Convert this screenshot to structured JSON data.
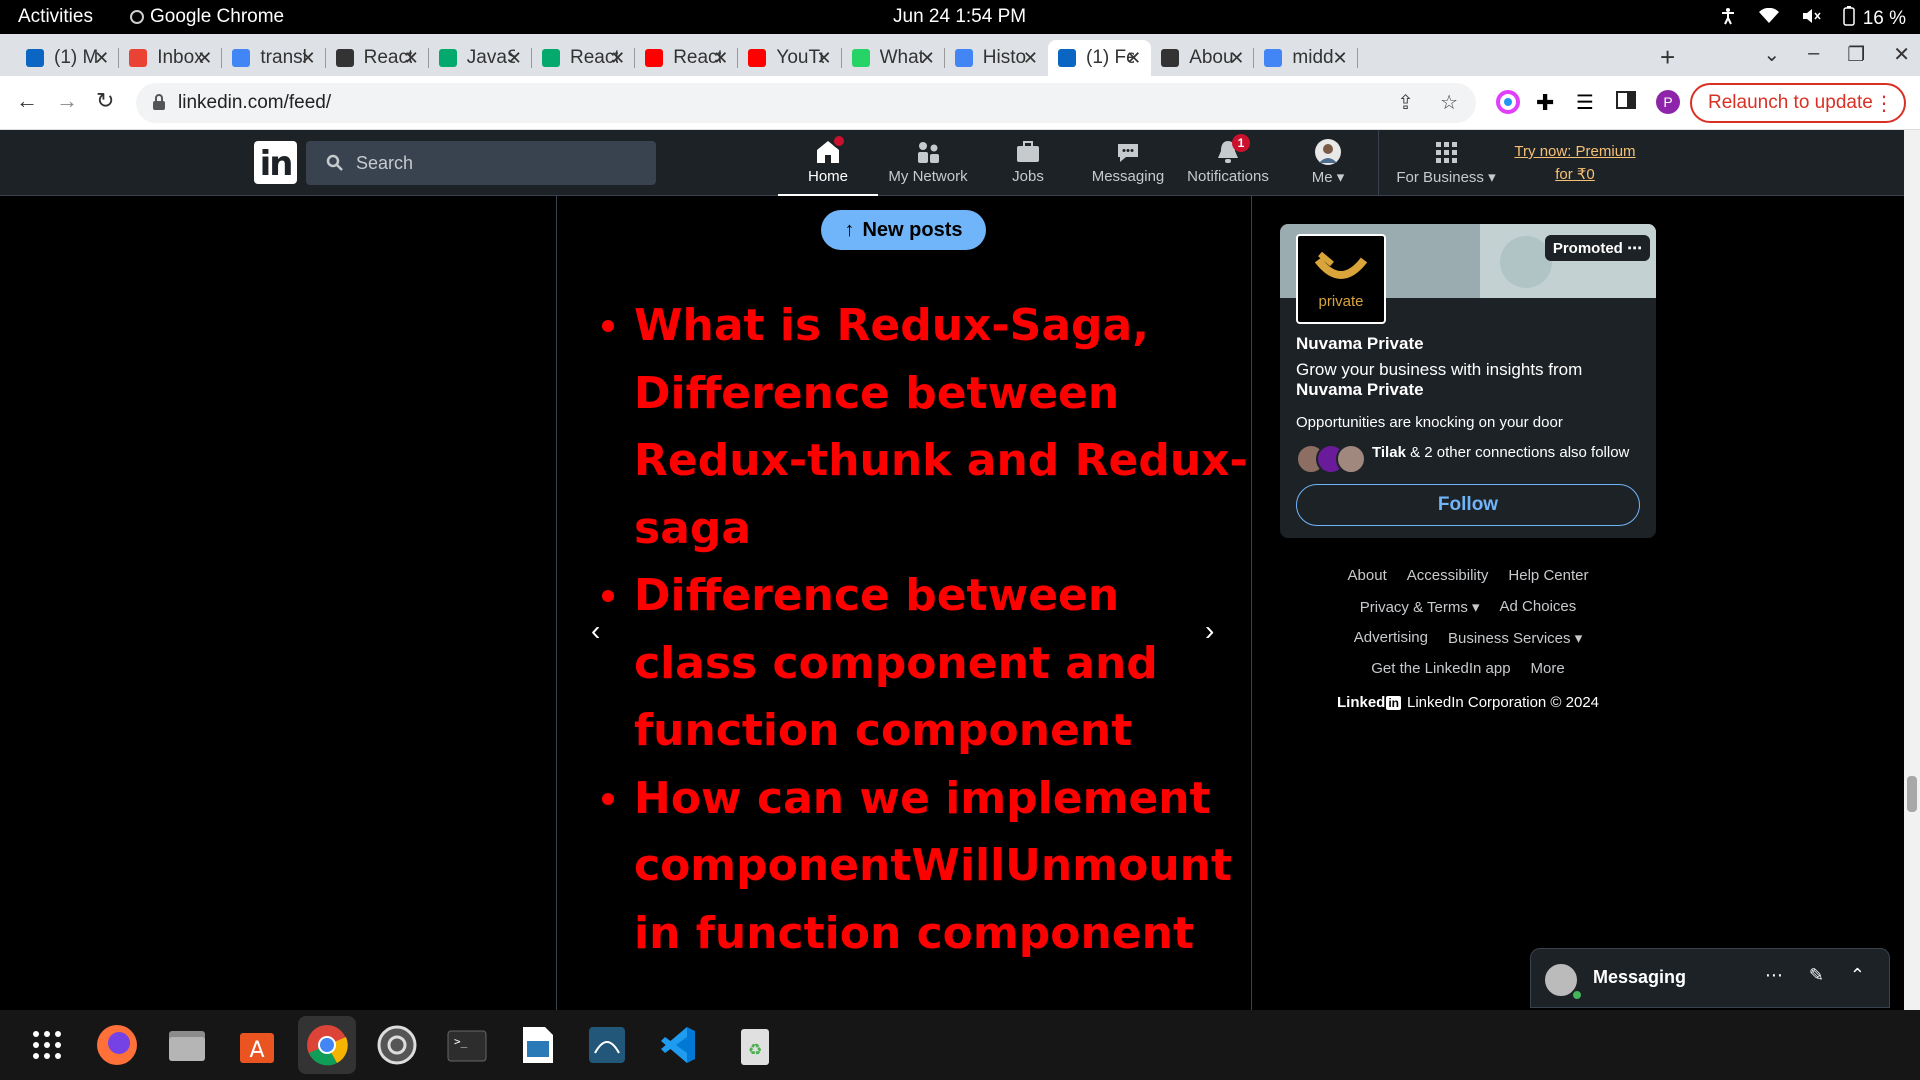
{
  "system_bar": {
    "activities": "Activities",
    "app_name": "Google Chrome",
    "clock": "Jun 24  1:54 PM",
    "battery": "16 %"
  },
  "tabs": [
    {
      "title": "(1) M",
      "favicon": "linkedin-icon",
      "color": "#0a66c2"
    },
    {
      "title": "Inbox",
      "favicon": "gmail-icon",
      "color": "#ea4335"
    },
    {
      "title": "transl",
      "favicon": "google-icon",
      "color": "#4285f4"
    },
    {
      "title": "React",
      "favicon": "openai-icon",
      "color": "#333333"
    },
    {
      "title": "JavaS",
      "favicon": "w3schools-icon",
      "color": "#04aa6d"
    },
    {
      "title": "React",
      "favicon": "w3schools-icon",
      "color": "#04aa6d"
    },
    {
      "title": "React",
      "favicon": "youtube-icon",
      "color": "#ff0000"
    },
    {
      "title": "YouTu",
      "favicon": "youtube-icon",
      "color": "#ff0000"
    },
    {
      "title": "What",
      "favicon": "whatsapp-icon",
      "color": "#25d366"
    },
    {
      "title": "Histo",
      "favicon": "history-icon",
      "color": "#4285f4"
    },
    {
      "title": "(1) Fe",
      "favicon": "linkedin-icon",
      "color": "#0a66c2"
    },
    {
      "title": "Abou",
      "favicon": "location-pin-icon",
      "color": "#333333"
    },
    {
      "title": "midd",
      "favicon": "google-icon",
      "color": "#4285f4"
    }
  ],
  "active_tab_index": 10,
  "toolbar": {
    "url": "linkedin.com/feed/",
    "relaunch_label": "Relaunch to update",
    "profile_initial": "P"
  },
  "linkedin": {
    "search_placeholder": "Search",
    "nav": {
      "home": "Home",
      "network": "My Network",
      "jobs": "Jobs",
      "messaging": "Messaging",
      "notifications": "Notifications",
      "me": "Me",
      "business": "For Business"
    },
    "notifications_count": "1",
    "premium_line1": "Try now: Premium",
    "premium_line2": "for ₹0"
  },
  "post": {
    "new_posts_label": "New posts",
    "slide_items": [
      "What is Redux-Saga, Difference between Redux-thunk and Redux-saga",
      "Difference between class component and function component",
      "How can we implement componentWillUnmount in function component"
    ],
    "prev_arrow": "‹",
    "next_arrow": "›"
  },
  "ad": {
    "promoted_label": "Promoted",
    "logo_word": "private",
    "company": "Nuvama Private",
    "tagline_prefix": "Grow your business with insights from",
    "tagline_company": "Nuvama Private",
    "opportunities": "Opportunities are knocking on your door",
    "connection_name": "Tilak",
    "connection_rest": " & 2 other connections also follow",
    "follow_label": "Follow"
  },
  "footer": {
    "row1": [
      "About",
      "Accessibility",
      "Help Center"
    ],
    "row2": [
      "Privacy & Terms",
      "Ad Choices"
    ],
    "row3": [
      "Advertising",
      "Business Services"
    ],
    "row4": [
      "Get the LinkedIn app",
      "More"
    ],
    "brand_text": "Linked",
    "brand_in": "in",
    "copyright": "LinkedIn Corporation © 2024"
  },
  "messaging": {
    "title": "Messaging"
  },
  "colors": {
    "slide_text": "#ff0000",
    "linkedin_blue": "#70b5f9",
    "relaunch_red": "#d93025",
    "premium_gold": "#f5c075"
  }
}
